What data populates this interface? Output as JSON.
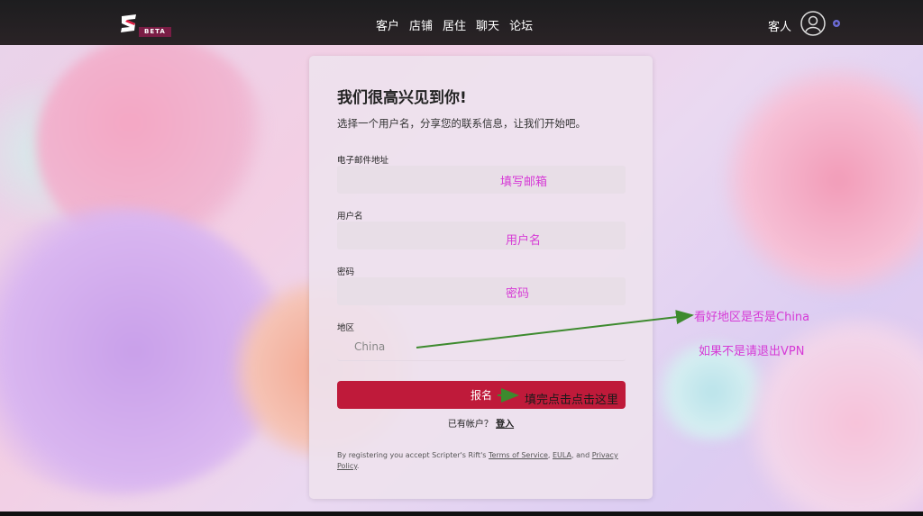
{
  "header": {
    "nav": [
      "客户",
      "店铺",
      "居住",
      "聊天",
      "论坛"
    ],
    "guest_label": "客人",
    "beta_badge": "BETA"
  },
  "form": {
    "title": "我们很高兴见到你!",
    "subtitle": "选择一个用户名，分享您的联系信息，让我们开始吧。",
    "email_label": "电子邮件地址",
    "username_label": "用户名",
    "password_label": "密码",
    "region_label": "地区",
    "region_value": "China",
    "submit_label": "报名",
    "have_account": "已有帐户？",
    "login_link": "登入",
    "legal_prefix": "By registering you accept Scripter's Rift's ",
    "tos": "Terms of Service",
    "sep1": ", ",
    "eula": "EULA",
    "sep2": ", and ",
    "privacy": "Privacy Policy",
    "legal_end": "."
  },
  "annotations": {
    "email_hint": "填写邮箱",
    "username_hint": "用户名",
    "password_hint": "密码",
    "region_check": "看好地区是否是China",
    "vpn_hint": "如果不是请退出VPN",
    "submit_hint": "填完点击点击这里"
  },
  "colors": {
    "accent": "#bf1a3a",
    "annotation": "#d63ad6",
    "arrow": "#3d8a2e"
  }
}
